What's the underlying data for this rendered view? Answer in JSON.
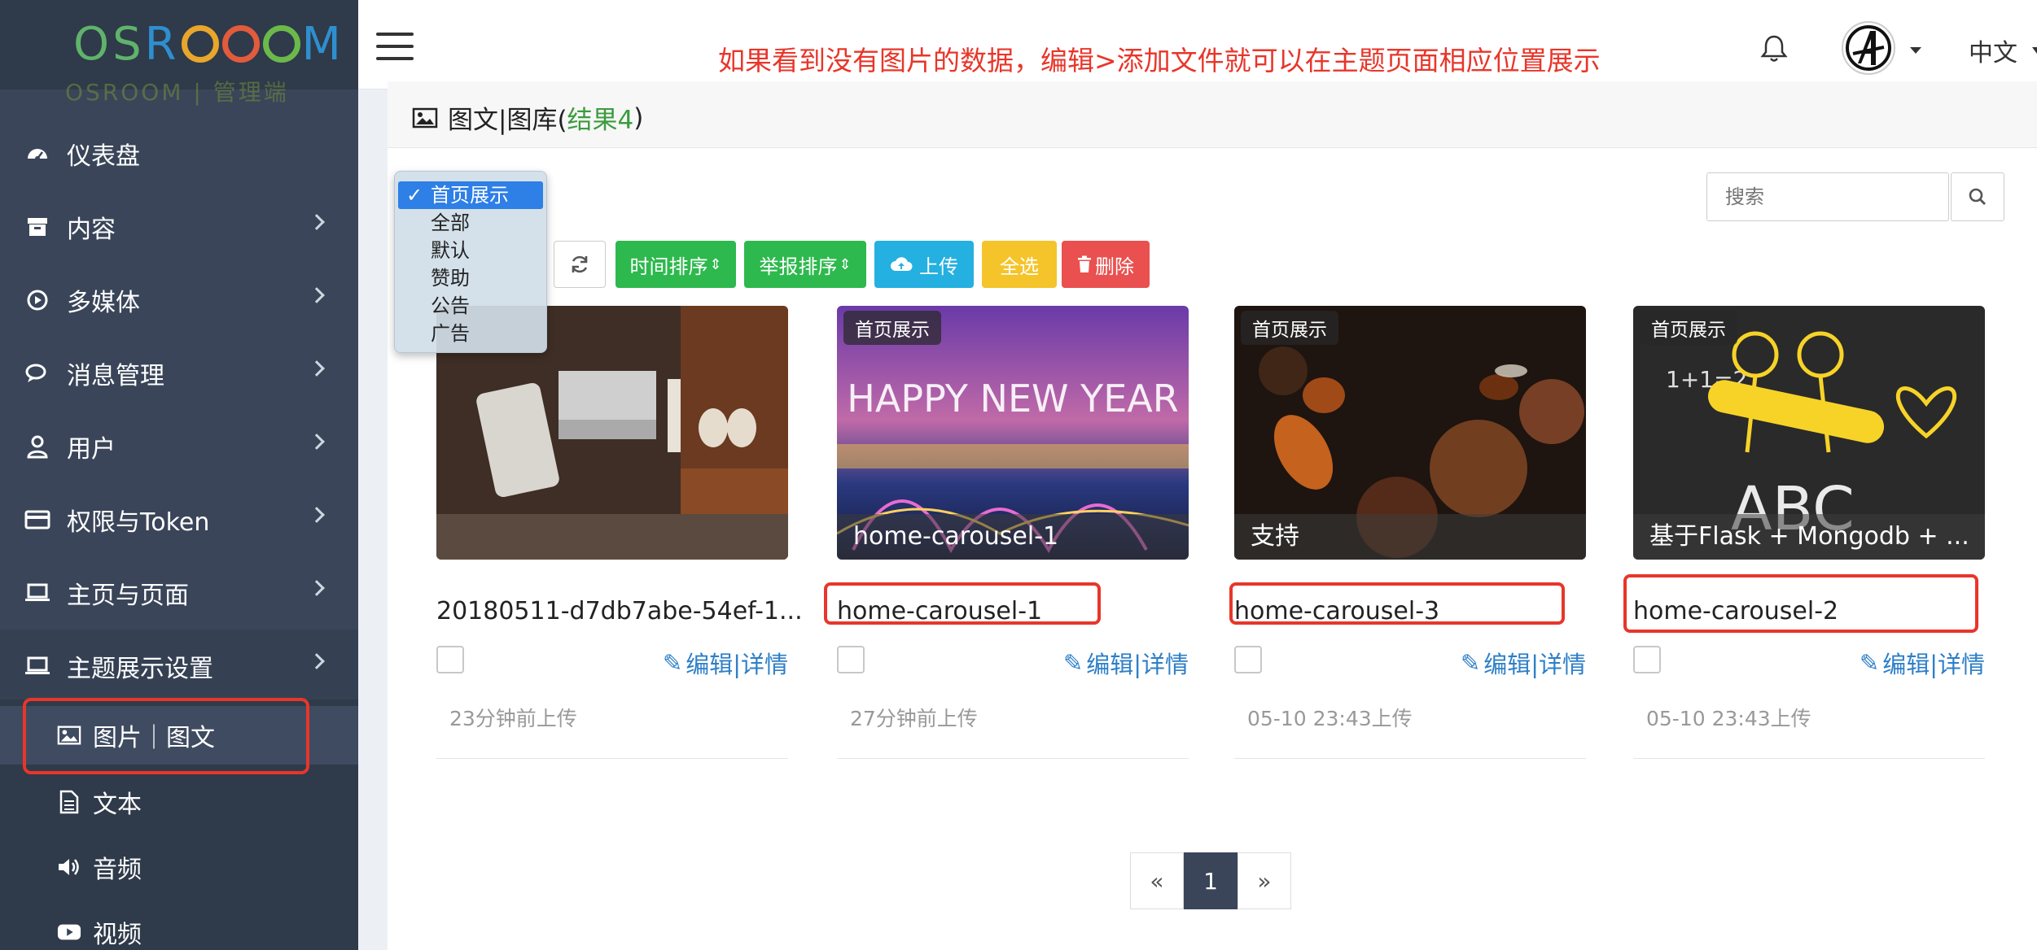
{
  "brand": {
    "logo_letters_1": "OS",
    "logo_letters_2": "R",
    "logo_letters_3": "M",
    "logo_sub": "OSROOM | 管理端"
  },
  "sidebar": {
    "items": [
      {
        "label": "仪表盘",
        "icon": "dashboard-icon",
        "has_arrow": false
      },
      {
        "label": "内容",
        "icon": "archive-icon",
        "has_arrow": true
      },
      {
        "label": "多媒体",
        "icon": "play-circle-icon",
        "has_arrow": true
      },
      {
        "label": "消息管理",
        "icon": "comments-icon",
        "has_arrow": true
      },
      {
        "label": "用户",
        "icon": "user-icon",
        "has_arrow": true
      },
      {
        "label": "权限与Token",
        "icon": "credit-card-icon",
        "has_arrow": true
      },
      {
        "label": "主页与页面",
        "icon": "laptop-icon",
        "has_arrow": true
      },
      {
        "label": "主题展示设置",
        "icon": "laptop-icon",
        "has_arrow": true
      }
    ],
    "sub_items": [
      {
        "label": "图片｜图文",
        "icon": "image-icon"
      },
      {
        "label": "文本",
        "icon": "file-text-icon"
      },
      {
        "label": "音频",
        "icon": "volume-icon"
      },
      {
        "label": "视频",
        "icon": "youtube-icon"
      }
    ]
  },
  "topbar": {
    "notice": "如果看到没有图片的数据，编辑>添加文件就可以在主题页面相应位置展示",
    "language": "中文"
  },
  "panel": {
    "title": "图文|图库(",
    "count_label": "结果4",
    "title_close": ")"
  },
  "filter": {
    "options": [
      "首页展示",
      "全部",
      "默认",
      "赞助",
      "公告",
      "广告"
    ],
    "selected": "首页展示"
  },
  "toolbar": {
    "time_sort": "时间排序",
    "report_sort": "举报排序",
    "upload": "上传",
    "select_all": "全选",
    "delete": "删除"
  },
  "search": {
    "placeholder": "搜索"
  },
  "cards": [
    {
      "badge": "",
      "caption": "",
      "name": "20180511-d7db7abe-54ef-1...",
      "edit": "编辑|详情",
      "time": "23分钟前上传"
    },
    {
      "badge": "首页展示",
      "caption": "home-carousel-1",
      "name": "home-carousel-1",
      "edit": "编辑|详情",
      "time": "27分钟前上传"
    },
    {
      "badge": "首页展示",
      "caption": "支持",
      "name": "home-carousel-3",
      "edit": "编辑|详情",
      "time": "05-10 23:43上传"
    },
    {
      "badge": "首页展示",
      "caption": "基于Flask + Mongodb + ...",
      "name": "home-carousel-2",
      "edit": "编辑|详情",
      "time": "05-10 23:43上传"
    }
  ],
  "pagination": {
    "prev": "«",
    "current": "1",
    "next": "»"
  },
  "colors": {
    "sidebar": "#3a4559",
    "accent_red": "#e8362a",
    "success": "#2db94d",
    "info": "#24b0e0",
    "warning": "#f4c42a",
    "danger": "#e9504f"
  }
}
